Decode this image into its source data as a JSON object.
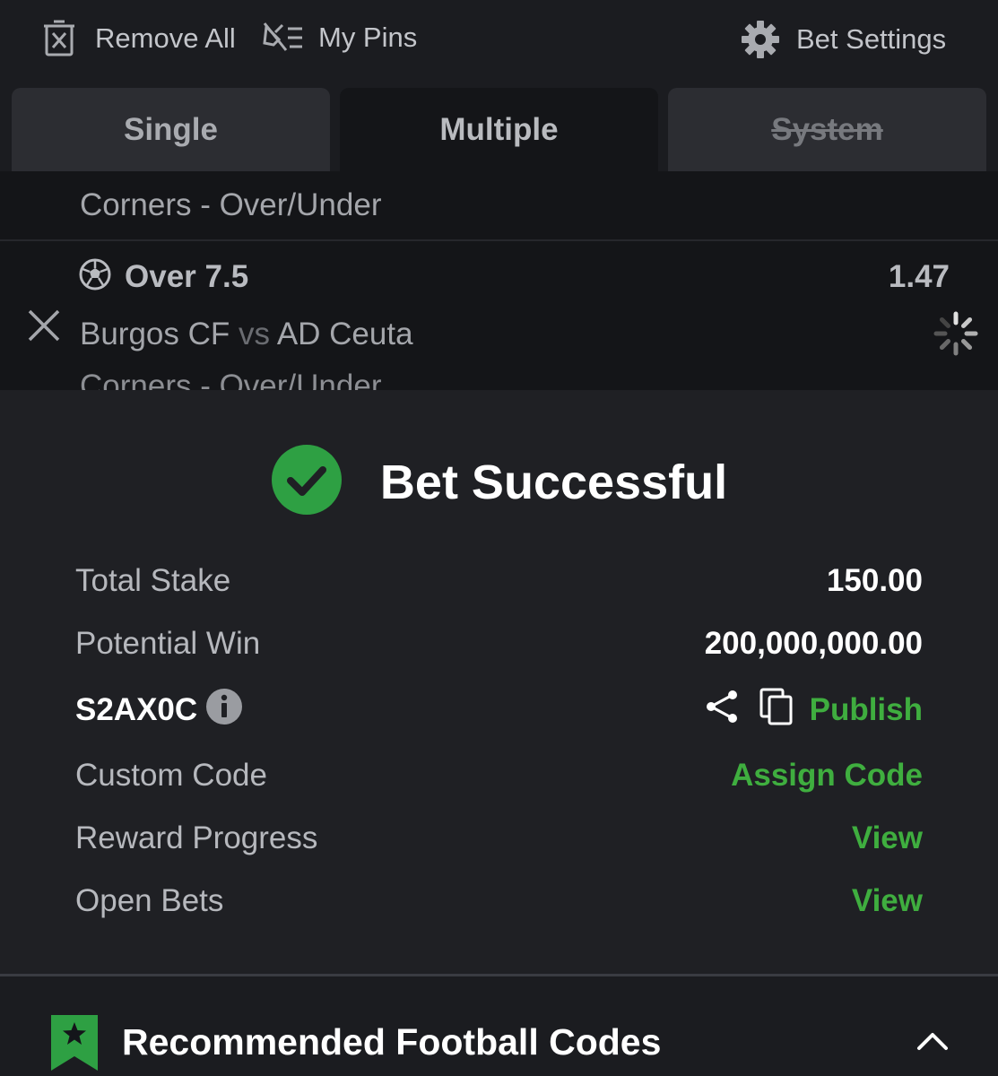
{
  "topbar": {
    "remove_all": "Remove All",
    "my_pins": "My Pins",
    "bet_settings": "Bet Settings"
  },
  "tabs": [
    {
      "label": "Single",
      "state": "inactive"
    },
    {
      "label": "Multiple",
      "state": "active"
    },
    {
      "label": "System",
      "state": "disabled"
    }
  ],
  "slip": {
    "market_above": "Corners - Over/Under",
    "selection": "Over 7.5",
    "odds": "1.47",
    "home_team": "Burgos CF",
    "vs": "vs",
    "away_team": "AD Ceuta",
    "market": "Corners - Over/Under"
  },
  "result": {
    "title": "Bet Successful",
    "rows": {
      "total_stake_label": "Total Stake",
      "total_stake_value": "150.00",
      "potential_win_label": "Potential Win",
      "potential_win_value": "200,000,000.00",
      "booking_code": "S2AX0C",
      "publish": "Publish",
      "custom_code_label": "Custom Code",
      "assign_code": "Assign Code",
      "reward_progress_label": "Reward Progress",
      "reward_view": "View",
      "open_bets_label": "Open Bets",
      "open_bets_view": "View"
    }
  },
  "recommended": {
    "title": "Recommended Football Codes"
  },
  "colors": {
    "accent_green": "#3fae3f",
    "success_green": "#2ea043",
    "background": "#1b1c20",
    "panel": "#1f2024"
  },
  "icons": [
    "trash-icon",
    "pin-icon",
    "gear-icon",
    "soccer-ball-icon",
    "close-icon",
    "spinner-icon",
    "check-circle-icon",
    "info-icon",
    "share-icon",
    "copy-icon",
    "bookmark-star-icon",
    "chevron-up-icon"
  ]
}
